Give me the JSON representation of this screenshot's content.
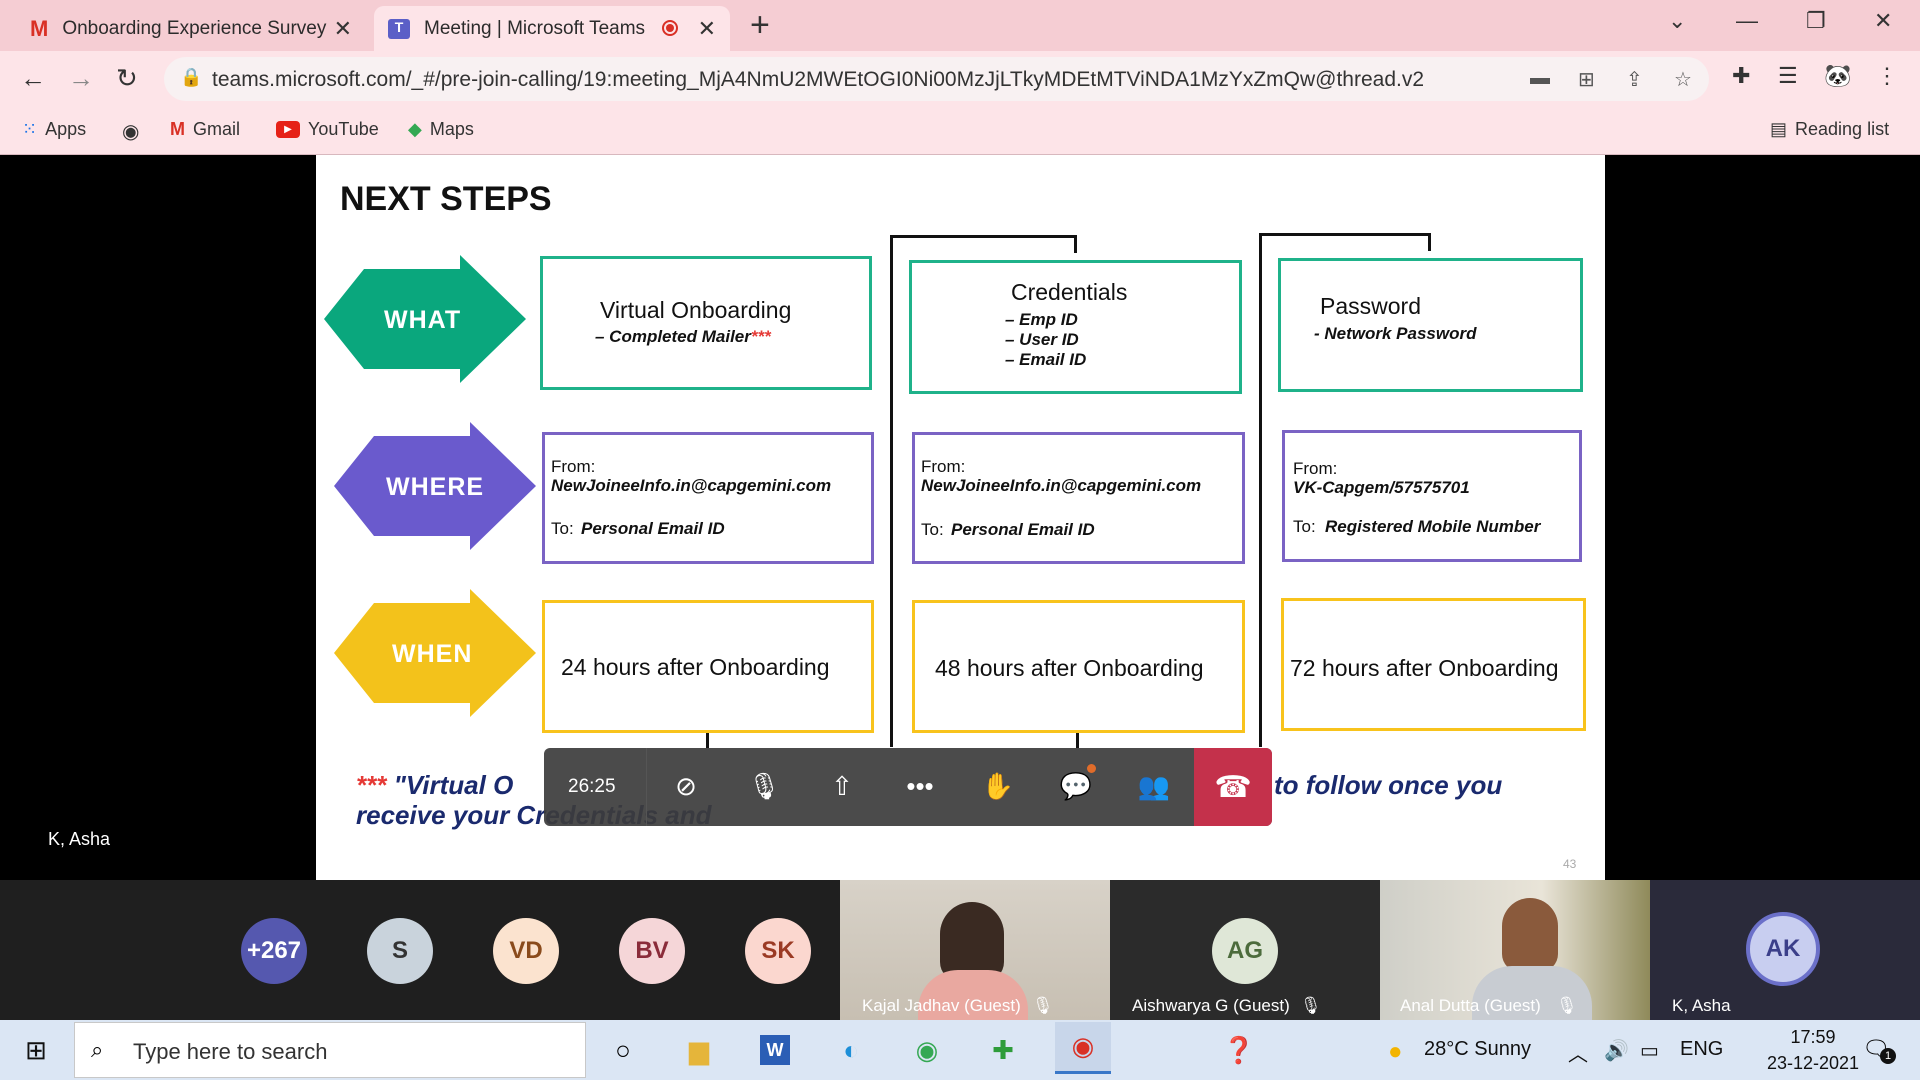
{
  "browser": {
    "tabs": [
      {
        "title": "Onboarding Experience Survey -",
        "icon": "gmail-icon"
      },
      {
        "title": "Meeting | Microsoft Teams",
        "icon": "teams-icon",
        "recording": true
      }
    ],
    "url": "teams.microsoft.com/_#/pre-join-calling/19:meeting_MjA4NmU2MWEtOGI0Ni00MzJjLTkyMDEtMTViNDA1MzYxZmQw@thread.v2",
    "bookmarks": [
      "Apps",
      "Gmail",
      "YouTube",
      "Maps"
    ],
    "reading_list": "Reading list"
  },
  "slide": {
    "title": "NEXT STEPS",
    "rows": [
      "WHAT",
      "WHERE",
      "WHEN"
    ],
    "what": [
      {
        "title": "Virtual Onboarding",
        "items": [
          "– Completed Mailer"
        ],
        "mark": "***"
      },
      {
        "title": "Credentials",
        "items": [
          "– Emp ID",
          "– User ID",
          "– Email ID"
        ]
      },
      {
        "title": "Password",
        "items": [
          "- Network Password"
        ]
      }
    ],
    "where": [
      {
        "from_label": "From:",
        "from": "NewJoineeInfo.in@capgemini.com",
        "to_label": "To:",
        "to": "Personal Email ID"
      },
      {
        "from_label": "From:",
        "from": "NewJoineeInfo.in@capgemini.com",
        "to_label": "To:",
        "to": "Personal Email ID"
      },
      {
        "from_label": "From:",
        "from": "VK-Capgem/57575701",
        "to_label": "To:",
        "to": "Registered Mobile Number"
      }
    ],
    "when": [
      "24 hours after Onboarding",
      "48 hours after Onboarding",
      "72 hours after Onboarding"
    ],
    "footnote_mark": "***",
    "footnote_line1_a": "\"Virtual O",
    "footnote_line1_b": "to follow once you",
    "footnote_line2": "receive your Credentials and",
    "page_number": "43"
  },
  "meeting": {
    "presenter": "K, Asha",
    "timer": "26:25",
    "overflow_count": "+267",
    "avatars": [
      {
        "initials": "S",
        "bg": "#c9d3dc",
        "fg": "#333"
      },
      {
        "initials": "VD",
        "bg": "#fbe3cf",
        "fg": "#8a4b1c"
      },
      {
        "initials": "BV",
        "bg": "#f5d6d8",
        "fg": "#8a2c3a"
      },
      {
        "initials": "SK",
        "bg": "#fbd7cf",
        "fg": "#9b3a24"
      }
    ],
    "participants": [
      {
        "name": "Kajal Jadhav (Guest)"
      },
      {
        "name": "Aishwarya G (Guest)",
        "initials": "AG"
      },
      {
        "name": "Anal Dutta (Guest)"
      },
      {
        "name": "K, Asha",
        "initials": "AK"
      }
    ]
  },
  "taskbar": {
    "search_placeholder": "Type here to search",
    "weather": "28°C  Sunny",
    "language": "ENG",
    "time": "17:59",
    "date": "23-12-2021",
    "notifications": "1"
  },
  "colors": {
    "what": "#0aa77d",
    "where": "#6a5acd",
    "when": "#f3c21b",
    "leave": "#c4314b"
  }
}
